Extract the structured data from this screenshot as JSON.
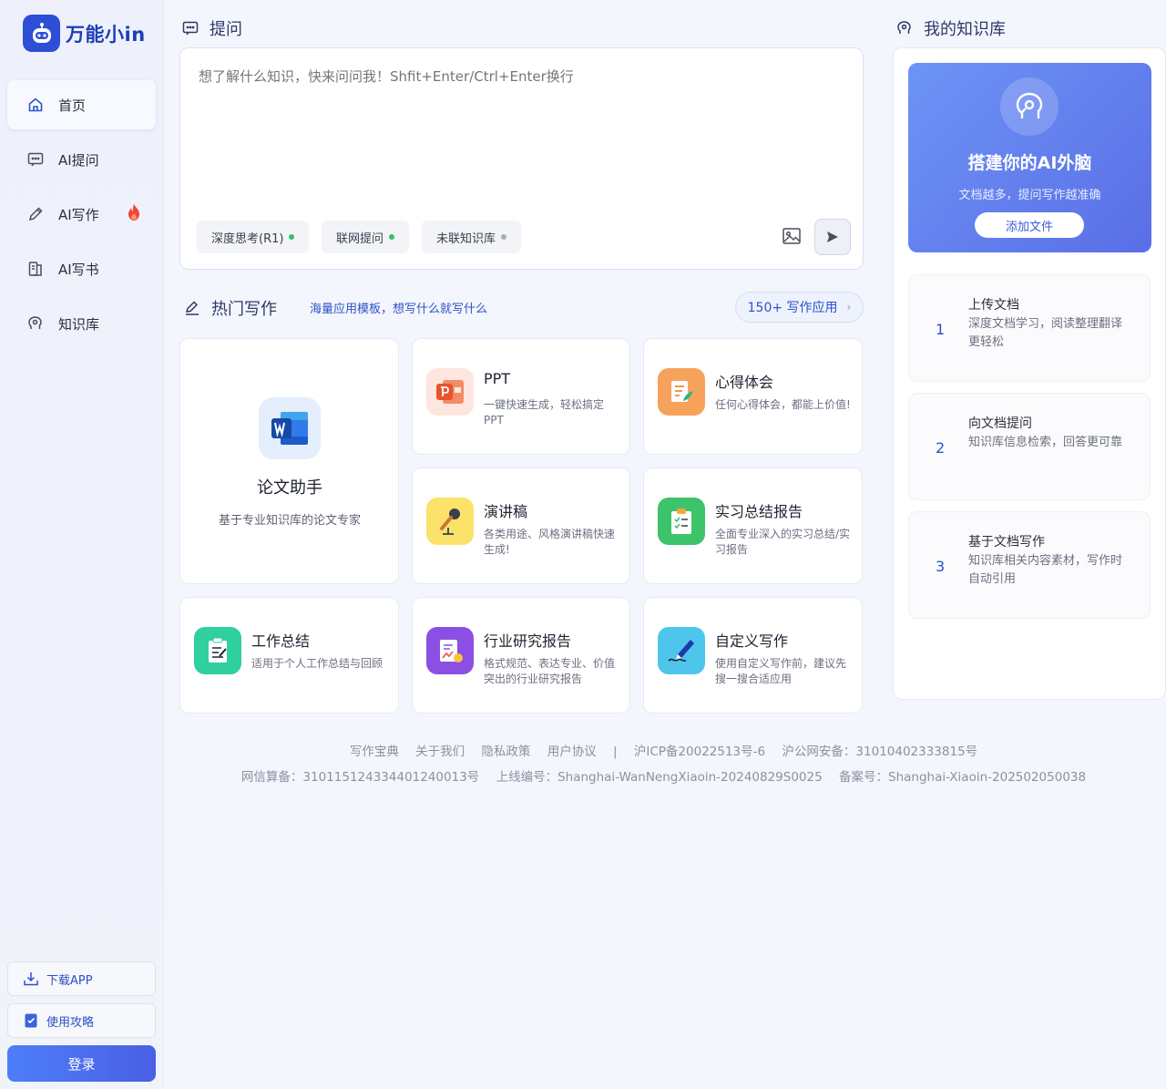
{
  "brand": {
    "name": "万能小in"
  },
  "nav": {
    "items": [
      {
        "label": "首页",
        "icon": "home-icon"
      },
      {
        "label": "AI提问",
        "icon": "chat-icon"
      },
      {
        "label": "AI写作",
        "icon": "pen-icon"
      },
      {
        "label": "AI写书",
        "icon": "book-icon"
      },
      {
        "label": "知识库",
        "icon": "brain-icon"
      }
    ],
    "download_label": "下载APP",
    "guide_label": "使用攻略",
    "login_label": "登录"
  },
  "ask": {
    "title": "提问",
    "placeholder": "想了解什么知识，快来问问我！Shfit+Enter/Ctrl+Enter换行",
    "chips": [
      {
        "label": "深度思考(R1)",
        "dot_color": "#2fbf71"
      },
      {
        "label": "联网提问",
        "dot_color": "#2fbf71"
      },
      {
        "label": "未联知识库",
        "dot_color": "#a9adb8"
      }
    ]
  },
  "hot": {
    "title": "热门写作",
    "subtitle": "海量应用模板，想写什么就写什么",
    "more_label": "150+ 写作应用",
    "featured": {
      "title": "论文助手",
      "desc": "基于专业知识库的论文专家",
      "icon": "word-icon"
    },
    "cards": [
      {
        "title": "PPT",
        "desc": "一键快速生成，轻松搞定PPT",
        "icon": "ppt-icon"
      },
      {
        "title": "心得体会",
        "desc": "任何心得体会，都能上价值!",
        "icon": "notes-icon"
      },
      {
        "title": "演讲稿",
        "desc": "各类用途、风格演讲稿快速生成!",
        "icon": "microphone-icon"
      },
      {
        "title": "实习总结报告",
        "desc": "全面专业深入的实习总结/实习报告",
        "icon": "clipboard-icon"
      },
      {
        "title": "工作总结",
        "desc": "适用于个人工作总结与回顾",
        "icon": "summary-icon"
      },
      {
        "title": "行业研究报告",
        "desc": "格式规范、表达专业、价值突出的行业研究报告",
        "icon": "report-icon"
      },
      {
        "title": "自定义写作",
        "desc": "使用自定义写作前，建议先搜一搜合适应用",
        "icon": "signature-icon"
      }
    ]
  },
  "footer": {
    "links": [
      "写作宝典",
      "关于我们",
      "隐私政策",
      "用户协议"
    ],
    "separator": "|",
    "icp": "沪ICP备20022513号-6",
    "police": "沪公网安备：31010402333815号",
    "line2": [
      "网信算备：310115124334401240013号",
      "上线编号：Shanghai-WanNengXiaoin-20240829S0025",
      "备案号：Shanghai-Xiaoin-202502050038"
    ]
  },
  "kb": {
    "title": "我的知识库",
    "hero_title": "搭建你的AI外脑",
    "hero_desc": "文档越多，提问写作越准确",
    "hero_button": "添加文件",
    "steps": [
      {
        "num": "1",
        "title": "上传文档",
        "desc": "深度文档学习，阅读整理翻译更轻松"
      },
      {
        "num": "2",
        "title": "向文档提问",
        "desc": "知识库信息检索，回答更可靠"
      },
      {
        "num": "3",
        "title": "基于文档写作",
        "desc": "知识库相关内容素材，写作时自动引用"
      }
    ]
  }
}
